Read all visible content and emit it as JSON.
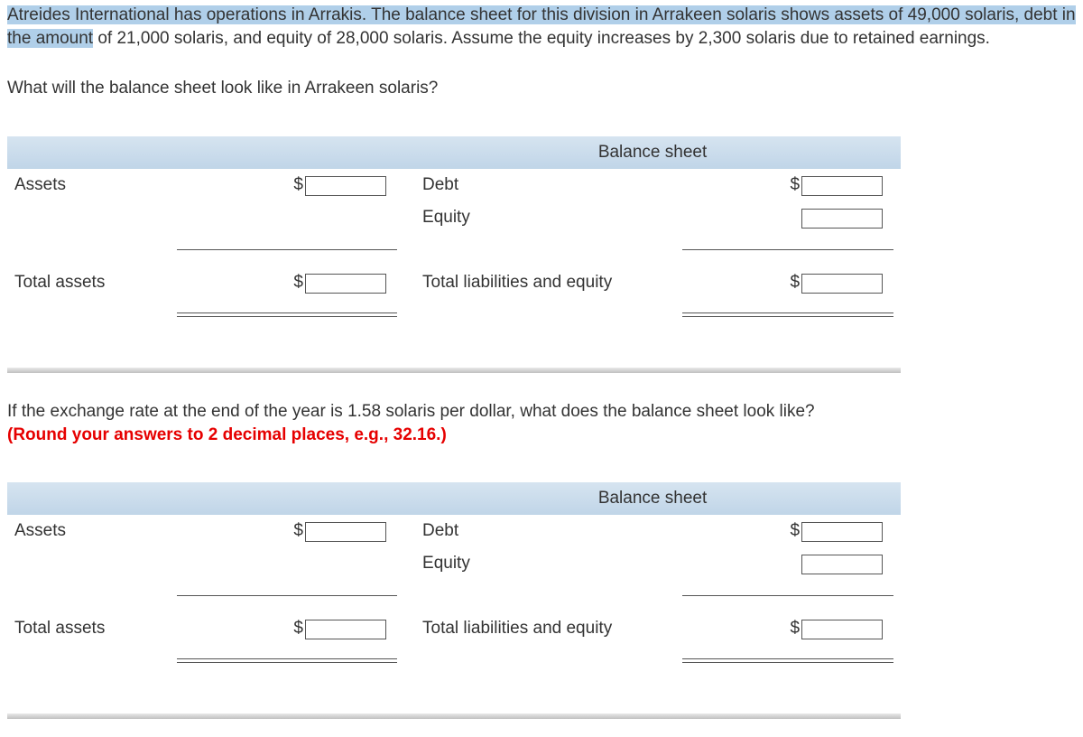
{
  "intro": {
    "selected_part": "Atreides International has operations in Arrakis. The balance sheet for this division in Arrakeen solaris shows assets of 49,000 solaris, debt in the amount",
    "rest_part": " of 21,000 solaris, and equity of 28,000 solaris. Assume the equity increases by 2,300 solaris due to retained earnings."
  },
  "q1_prompt": "What will the balance sheet look like in Arrakeen solaris?",
  "q2_prompt_part1": "If the exchange rate at the end of the year is 1.58 solaris per dollar, what does the balance sheet look like? ",
  "q2_prompt_part2": "(Round your answers to 2 decimal places, e.g., 32.16.)",
  "sheet": {
    "header": "Balance sheet",
    "assets": "Assets",
    "debt": "Debt",
    "equity": "Equity",
    "total_assets": "Total assets",
    "total_liab_eq": "Total liabilities and equity",
    "currency": "$"
  }
}
